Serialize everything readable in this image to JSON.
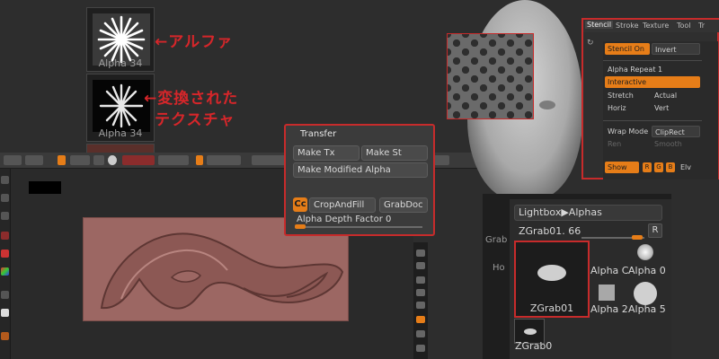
{
  "annotations": {
    "alpha": "←アルファ",
    "texture_line1": "←変換された",
    "texture_line2": "テクスチャ"
  },
  "thumbnails": [
    {
      "caption": "Alpha 34"
    },
    {
      "caption": "Alpha 34"
    }
  ],
  "transfer": {
    "title": "Transfer",
    "make_tx": "Make Tx",
    "make_st": "Make St",
    "make_modified_alpha": "Make Modified Alpha",
    "cc": "Cc",
    "crop_and_fill": "CropAndFill",
    "grab_doc": "GrabDoc",
    "depth_label": "Alpha Depth Factor",
    "depth_value": "0"
  },
  "stencil": {
    "tabs": [
      "Stencil",
      "Stroke",
      "Texture",
      "Tool",
      "Tr"
    ],
    "stencil_on": "Stencil On",
    "invert": "Invert",
    "alpha_repeat": "Alpha Repeat 1",
    "interactive": "Interactive",
    "stretch": "Stretch",
    "actual": "Actual",
    "horiz": "Horiz",
    "vert": "Vert",
    "wrap_mode": "Wrap Mode",
    "cliprect": "ClipRect",
    "ren": "Ren",
    "smooth": "Smooth",
    "show": "Show",
    "r": "R",
    "g": "G",
    "b": "B",
    "elv": "Elv"
  },
  "lightbox": {
    "path": "Lightbox▶Alphas",
    "zgrab_label": "ZGrab01. 66",
    "r_button": "R",
    "selected_caption": "ZGrab01",
    "cells": [
      "Alpha C",
      "Alpha 0",
      "Alpha 2",
      "Alpha 5"
    ],
    "mini_caption": "ZGrab0"
  },
  "side_labels": {
    "grab": "Grab",
    "ho": "Ho"
  }
}
